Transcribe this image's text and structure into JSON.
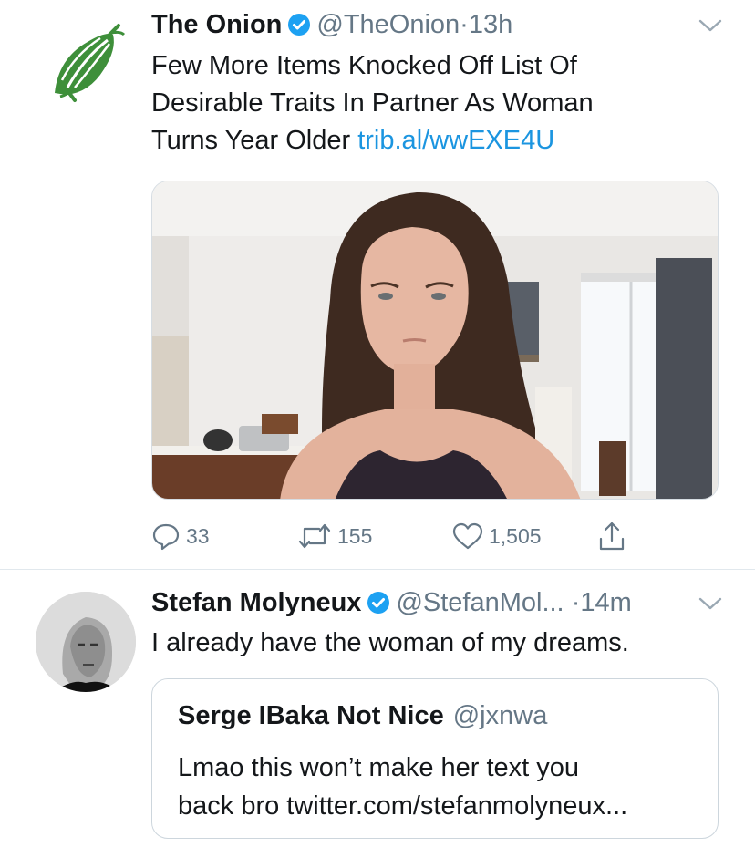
{
  "tweets": [
    {
      "author_name": "The Onion",
      "handle": "@TheOnion",
      "separator": "·",
      "time": "13h",
      "text": "Few More Items Knocked Off List Of Desirable Traits In Partner As Woman Turns Year Older",
      "text_line1": "Few More Items Knocked Off List Of",
      "text_line2": "Desirable Traits In Partner As Woman",
      "text_line3": "Turns Year Older",
      "link": "trib.al/wwEXE4U",
      "replies": "33",
      "retweets": "155",
      "likes": "1,505"
    },
    {
      "author_name": "Stefan Molyneux",
      "handle": "@StefanMol...",
      "separator": "·",
      "time": "14m",
      "text": "I already have the woman of my dreams.",
      "quote": {
        "author_name": "Serge IBaka Not Nice",
        "handle": "@jxnwa",
        "text_line1": "Lmao this won’t make her text you",
        "text_line2": "back bro twitter.com/stefanmolyneux..."
      }
    }
  ],
  "colors": {
    "onion_green": "#3e8f3a",
    "verified_blue": "#1da1f2",
    "link_blue": "#1b95e0",
    "muted_gray": "#657786",
    "divider": "#e1e8ed"
  },
  "icons": [
    "onion-logo-icon",
    "verified-badge-icon",
    "chevron-down-icon",
    "reply-icon",
    "retweet-icon",
    "like-icon",
    "share-icon"
  ]
}
